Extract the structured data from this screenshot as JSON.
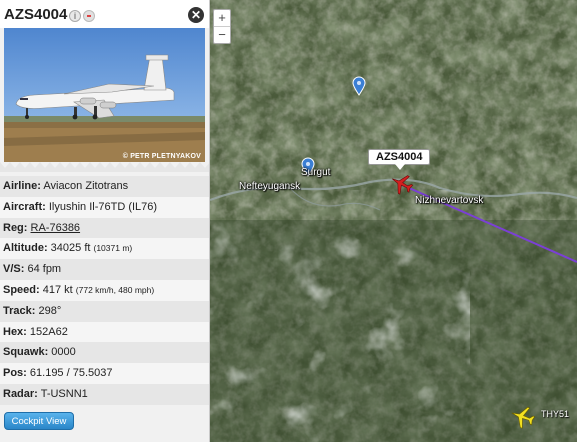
{
  "panel": {
    "flight_id": "AZS4004",
    "close_icon": "close-icon",
    "photo_credit": "© PETR PLETNYAKOV",
    "details": {
      "airline_label": "Airline:",
      "airline": "Aviacon Zitotrans",
      "aircraft_label": "Aircraft:",
      "aircraft": "Ilyushin Il-76TD (IL76)",
      "reg_label": "Reg:",
      "reg": "RA-76386",
      "altitude_label": "Altitude:",
      "altitude": "34025 ft",
      "altitude_m": "(10371 m)",
      "vs_label": "V/S:",
      "vs": "64 fpm",
      "speed_label": "Speed:",
      "speed": "417 kt",
      "speed_alt": "(772 km/h, 480 mph)",
      "track_label": "Track:",
      "track": "298°",
      "hex_label": "Hex:",
      "hex": "152A62",
      "squawk_label": "Squawk:",
      "squawk": "0000",
      "pos_label": "Pos:",
      "pos": "61.195 / 75.5037",
      "radar_label": "Radar:",
      "radar": "T-USNN1"
    },
    "cockpit_button": "Cockpit View"
  },
  "map": {
    "zoom_in": "+",
    "zoom_out": "−",
    "callsign_tag": "AZS4004",
    "cities": {
      "surgut": "Surgut",
      "nefteyugansk": "Nefteyugansk",
      "nizhnevartovsk": "Nizhnevartovsk"
    },
    "other_flight": "THY51",
    "route_color": "#7b3fd6",
    "selected_plane_color": "#d42020",
    "other_plane_color": "#f2e020"
  }
}
